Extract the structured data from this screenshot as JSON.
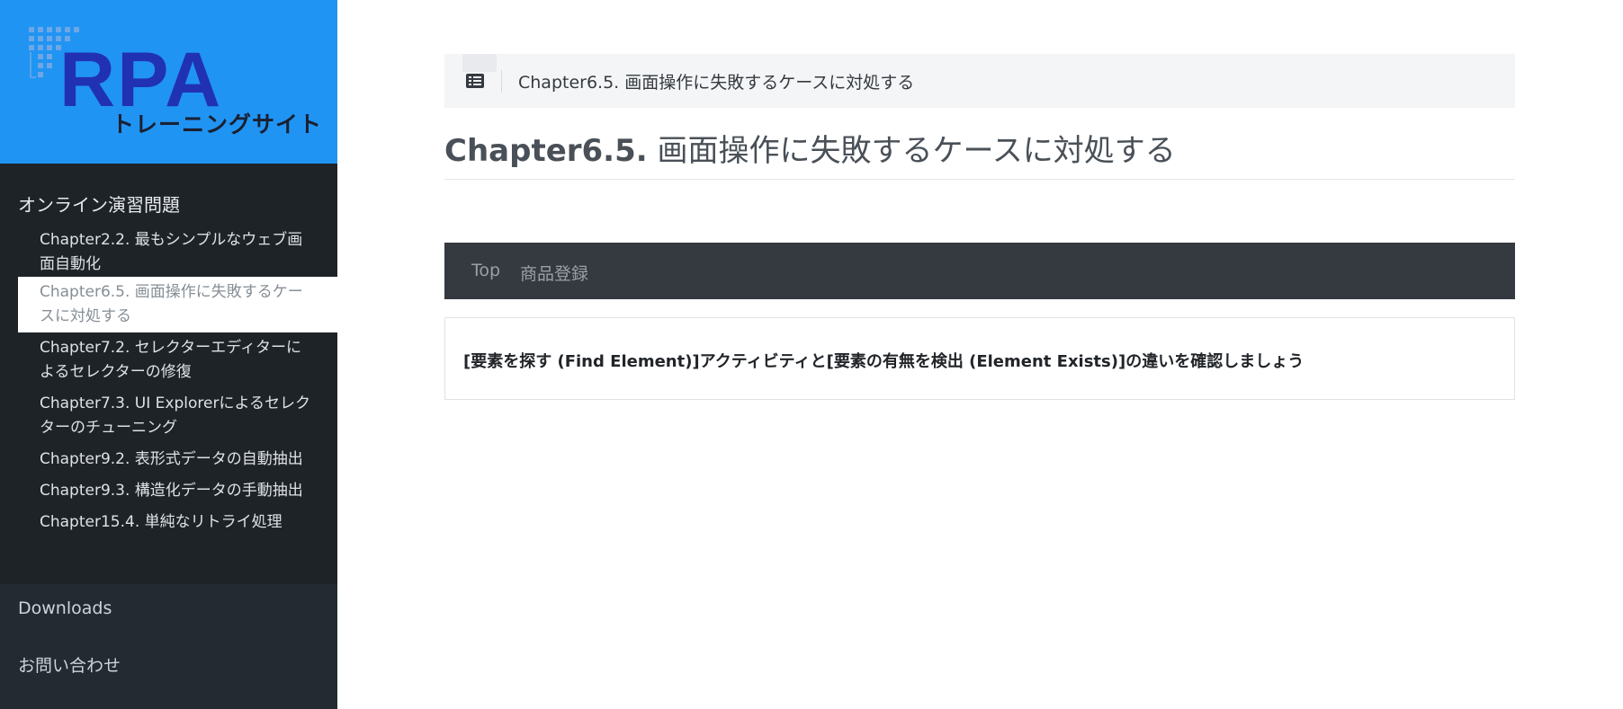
{
  "logo": {
    "title": "RPA",
    "subtitle": "トレーニングサイト",
    "brand_color": "#2094f3",
    "title_color": "#2131b4"
  },
  "sidebar": {
    "section_title": "オンライン演習問題",
    "items": [
      {
        "label_line1": "Chapter2.2. 最もシンプルなウェブ画",
        "label_line2": "面自動化",
        "active": false
      },
      {
        "label_line1": "Chapter6.5. 画面操作に失敗するケー",
        "label_line2": "スに対処する",
        "active": true
      },
      {
        "label_line1": "Chapter7.2. セレクターエディターに",
        "label_line2": "よるセレクターの修復",
        "active": false
      },
      {
        "label_line1": "Chapter7.3. UI Explorerによるセレク",
        "label_line2": "ターのチューニング",
        "active": false
      },
      {
        "label_line1": "Chapter9.2. 表形式データの自動抽出",
        "active": false
      },
      {
        "label_line1": "Chapter9.3. 構造化データの手動抽出",
        "active": false
      },
      {
        "label_line1": "Chapter15.4. 単純なリトライ処理",
        "active": false
      }
    ],
    "downloads": "Downloads",
    "contact": "お問い合わせ"
  },
  "breadcrumb": {
    "icon": "list-icon",
    "text": "Chapter6.5. 画面操作に失敗するケースに対処する"
  },
  "page": {
    "title_num": "Chapter6.5.",
    "title_text": " 画面操作に失敗するケースに対処する"
  },
  "navbar": {
    "items": [
      "Top",
      "商品登録"
    ]
  },
  "card": {
    "text": "[要素を探す (Find Element)]アクティビティと[要素の有無を検出 (Element Exists)]の違いを確認しましょう"
  }
}
